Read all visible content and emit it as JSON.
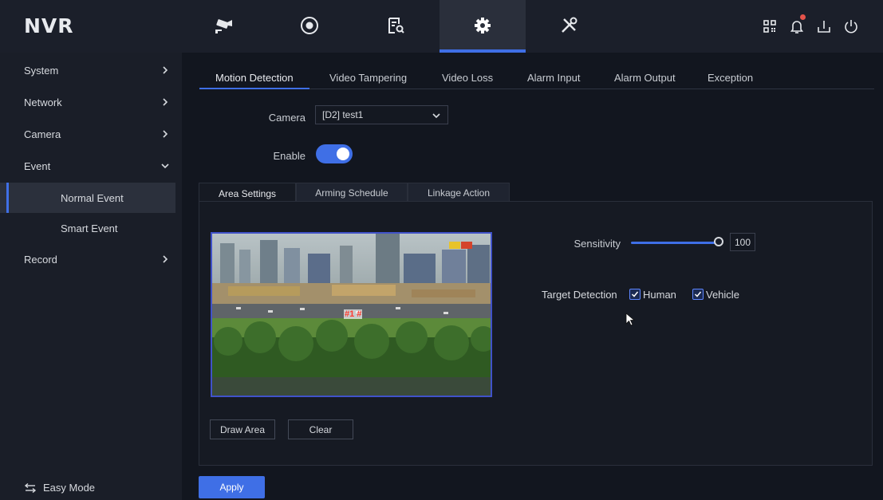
{
  "app": {
    "logo": "NVR"
  },
  "topnav": [
    {
      "name": "live-view-camera-icon"
    },
    {
      "name": "playback-icon"
    },
    {
      "name": "search-file-icon"
    },
    {
      "name": "settings-gear-icon",
      "active": true
    },
    {
      "name": "maintenance-tools-icon"
    }
  ],
  "topicons": [
    "qr-code-icon",
    "notification-bell-icon",
    "export-icon",
    "power-icon"
  ],
  "sidebar": {
    "items": [
      {
        "label": "System"
      },
      {
        "label": "Network"
      },
      {
        "label": "Camera"
      },
      {
        "label": "Event",
        "expanded": true
      },
      {
        "label": "Normal Event",
        "active": true
      },
      {
        "label": "Smart Event"
      },
      {
        "label": "Record"
      }
    ],
    "easy_mode": "Easy Mode"
  },
  "tabs": [
    "Motion Detection",
    "Video Tampering",
    "Video Loss",
    "Alarm Input",
    "Alarm Output",
    "Exception"
  ],
  "camera": {
    "label": "Camera",
    "value": "[D2] test1"
  },
  "enable": {
    "label": "Enable",
    "on": true
  },
  "subtabs": [
    "Area Settings",
    "Arming Schedule",
    "Linkage Action"
  ],
  "preview": {
    "area_label": "#1 #"
  },
  "sensitivity": {
    "label": "Sensitivity",
    "value": "100",
    "fraction": 1.0
  },
  "target_detection": {
    "label": "Target Detection",
    "human": {
      "label": "Human",
      "checked": true
    },
    "vehicle": {
      "label": "Vehicle",
      "checked": true
    }
  },
  "buttons": {
    "draw_area": "Draw Area",
    "clear": "Clear",
    "apply": "Apply"
  },
  "colors": {
    "accent": "#3f6fe6",
    "background": "#12161f",
    "sidebar": "#1a1e28",
    "notification": "#e5534b"
  }
}
